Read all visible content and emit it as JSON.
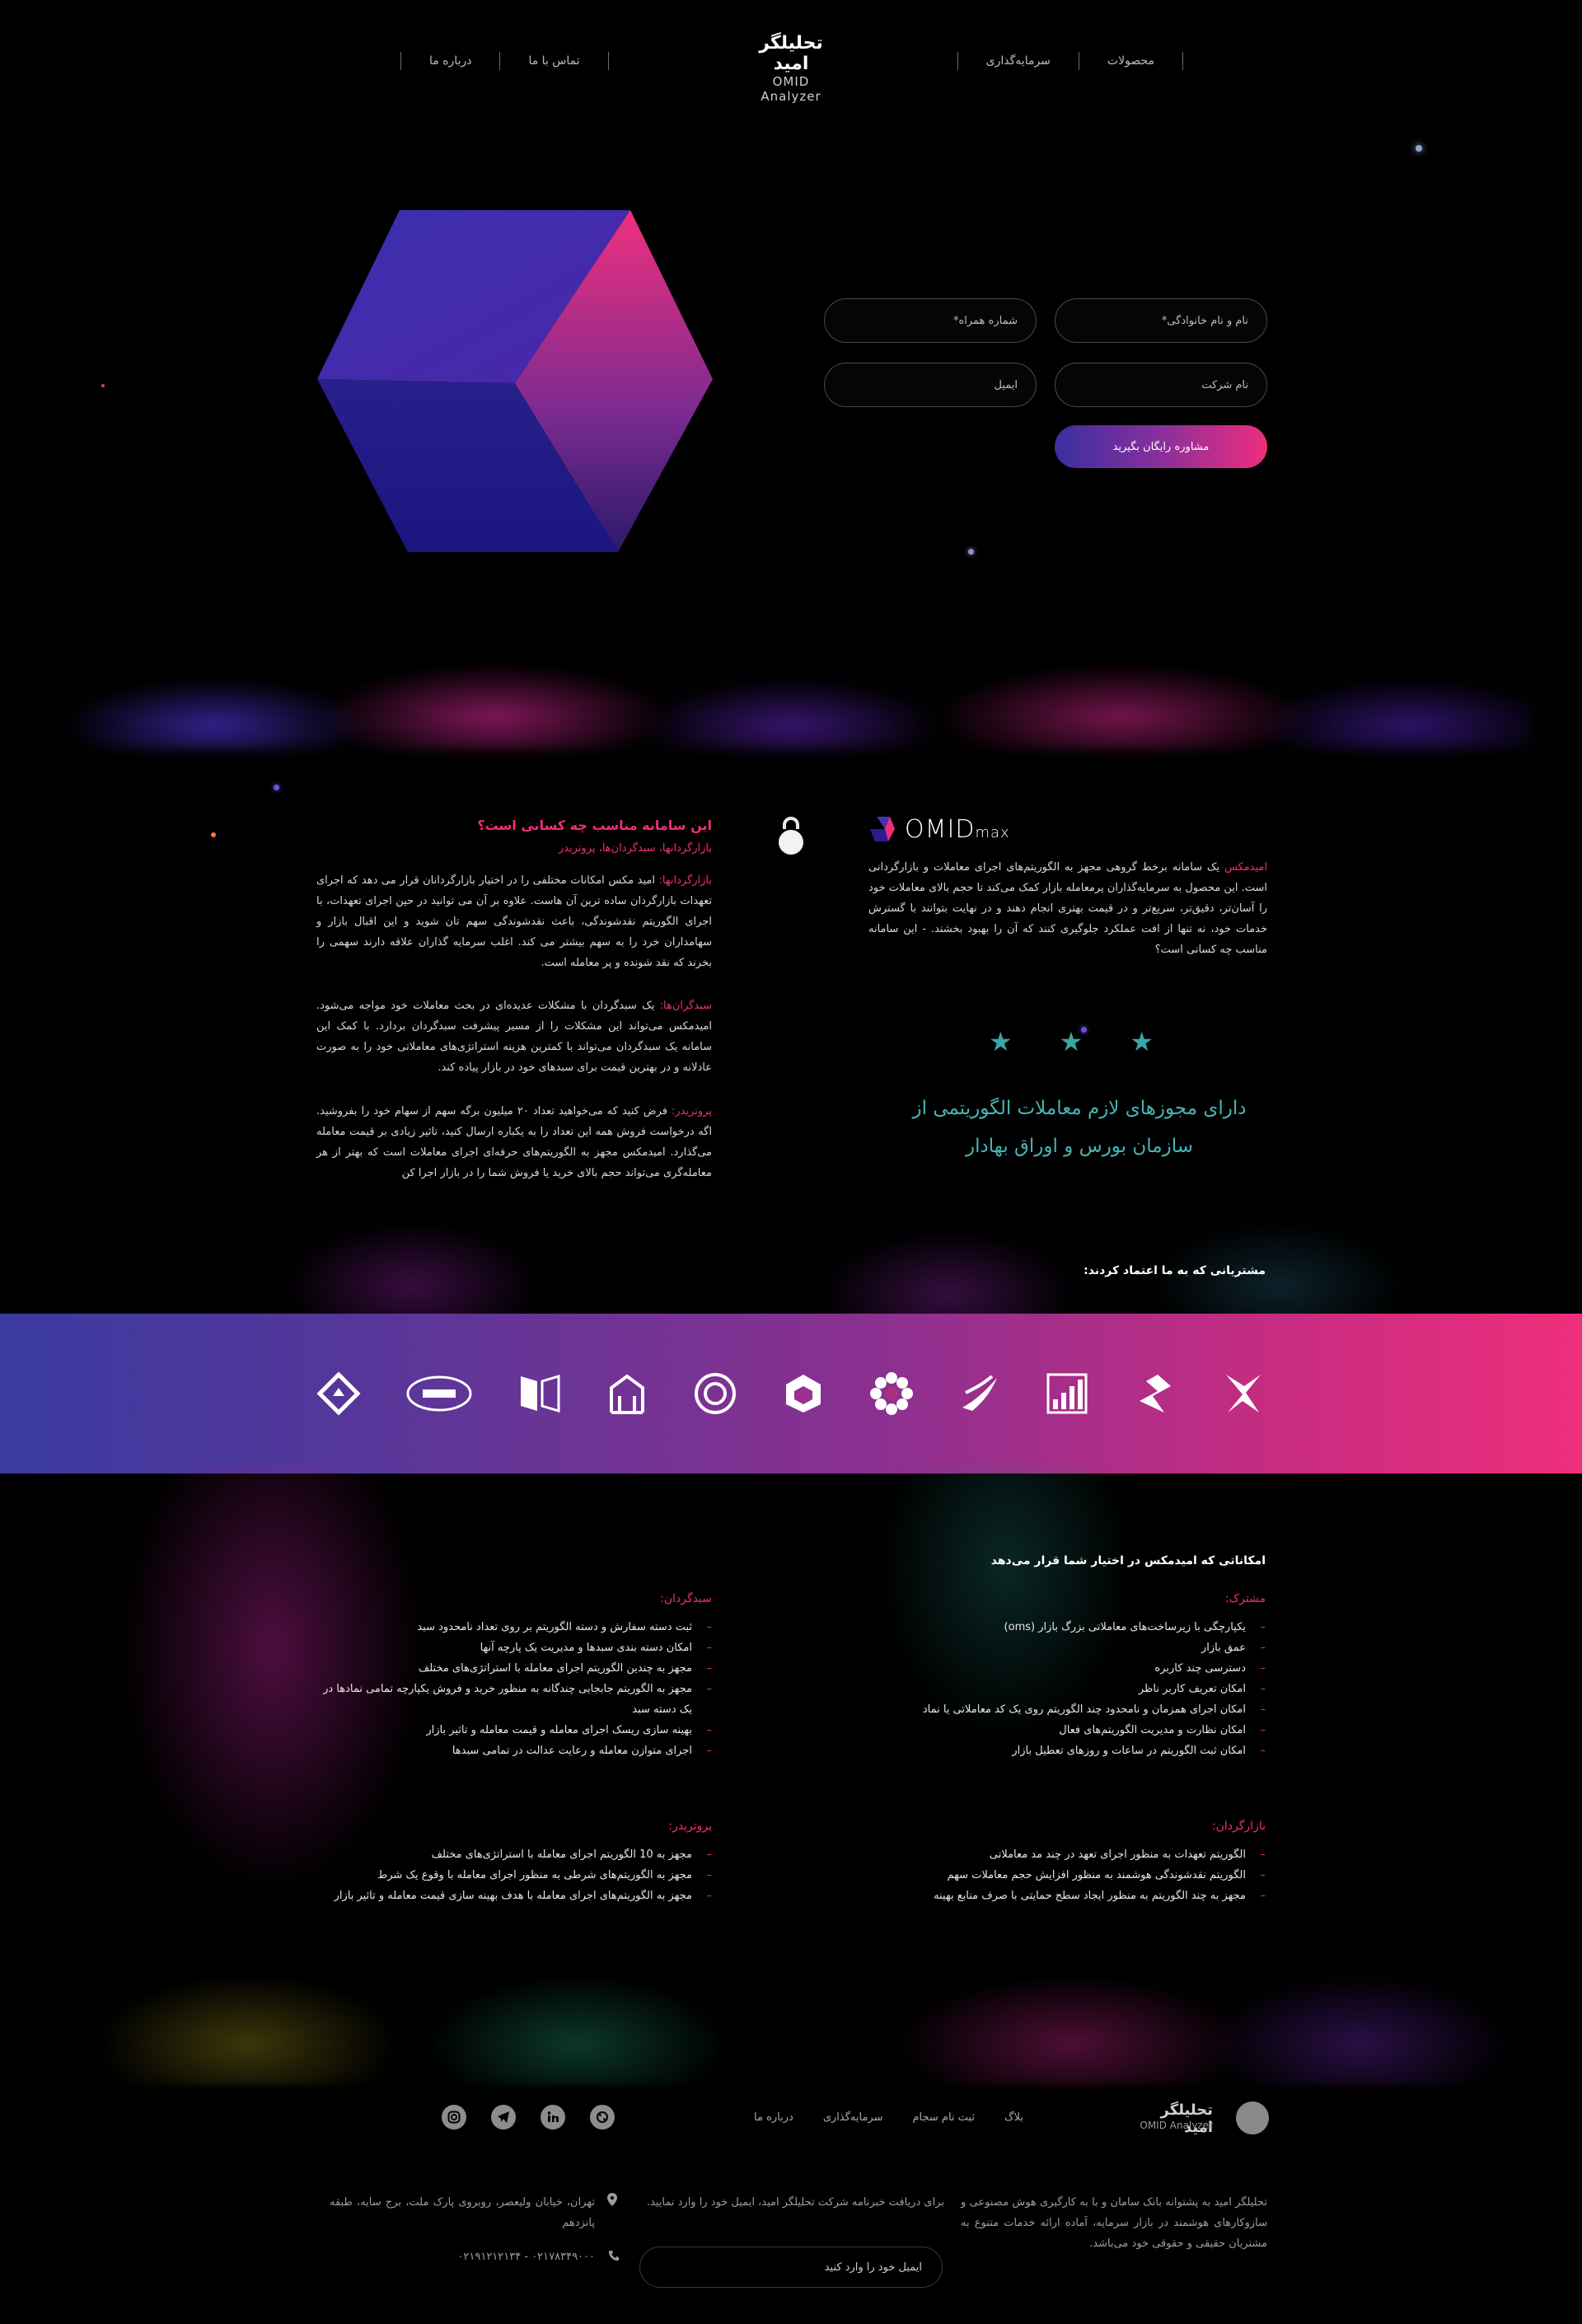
{
  "header": {
    "nav_right": [
      "محصولات",
      "سرمایه‌گذاری"
    ],
    "nav_left": [
      "تماس با ما",
      "درباره ما"
    ],
    "logo_fa": "تحلیلگر امید",
    "logo_en": "OMID Analyzer"
  },
  "form": {
    "name_placeholder": "نام و نام خانوادگی*",
    "phone_placeholder": "شماره همراه*",
    "company_placeholder": "نام شرکت",
    "email_placeholder": "ایمیل",
    "submit_label": "مشاوره رایگان بگیرید"
  },
  "product": {
    "logo_main": "OMID",
    "logo_sub": "max",
    "intro_highlight": "امیدمکس",
    "intro_text": " یک سامانه برخط گروهی مجهز به الگوریتم‌های اجرای معاملات و بازارگردانی است. این محصول به سرمایه‌گذاران پرمعامله بازار کمک می‌کند تا حجم بالای معاملات خود را آسان‌تر، دقیق‌تر، سریع‌تر و در قیمت بهتری انجام دهند و در نهایت بتوانند با گسترش خدمات خود، نه تنها از افت عملکرد جلوگیری کنند که آن را بهبود بخشند. - این سامانه مناسب چه کسانی است؟"
  },
  "audience": {
    "title": "این سامانه مناسب چه کسانی است؟",
    "subtitle": "بازارگردانها، سبدگردان‌ها، پروتریدر",
    "p1_highlight": "بازارگردانها:",
    "p1_text": " امید مکس امکانات مختلفی را در اختیار بازارگردانان قرار می دهد که اجرای تعهدات بازارگردان ساده ترین آن هاست. علاوه بر آن می توانید در حین اجرای تعهدات، با اجرای الگوریتم نقدشوندگی، باعث نقدشوندگی سهم تان شوید و این اقبال بازار و سهامداران خرد را به سهم بیشتر می کند. اغلب سرمایه گذاران علاقه دارند سهمی را بخرند که نقد شونده و پر معامله است.",
    "p2_highlight": "سبدگران‌ها:",
    "p2_text": " یک سبدگردان با مشکلات عدیده‌ای در بحث معاملات خود مواجه می‌شود. امیدمکس می‌تواند این مشکلات را از مسیر پیشرفت سبدگردان بردارد. با کمک این سامانه یک سبدگردان می‌تواند با کمترین هزینه استراتژی‌های معاملاتی خود را به صورت عادلانه و در بهترین قیمت برای سبدهای خود در بازار پیاده کند.",
    "p3_highlight": "پروتریدر:",
    "p3_text": " فرض کنید که می‌خواهید تعداد ۲۰ میلیون برگه سهم از سهام خود را بفروشید. اگه درخواست فروش همه این تعداد را به یکباره ارسال کنید، تاثیر زیادی بر قیمت معامله می‌گذارد. امیدمکس مجهز به الگوریتم‌های حرفه‌ای اجرای معاملات است که بهتر از هر معامله‌گری می‌تواند حجم بالای خرید یا فروش شما را در بازار اجرا کن"
  },
  "licence": {
    "stars": [
      "★",
      "★",
      "★"
    ],
    "line1": "دارای مجوزهای لازم معاملات الگوریتمی از",
    "line2": "سازمان بورس و اوراق بهادار"
  },
  "clients": {
    "title": "مشتریانی که به ما اعتماد کردند:"
  },
  "features": {
    "title": "امکاناتی که امیدمکس در اختیار شما قرار می‌دهد",
    "common_head": "مشترک:",
    "common": [
      "یکپارچگی با زیرساخت‌های معاملاتی بزرگ بازار (oms)",
      "عمق بازار",
      "دسترسی چند کاربره",
      "امکان تعریف کاربر ناظر",
      "امکان اجرای همزمان و نامحدود چند الگوریتم روی یک کد معاملاتی یا نماد",
      "امکان نظارت و مدیریت الگوریتم‌های فعال",
      "امکان ثبت الگوریتم در ساعات و روزهای تعطیل بازار"
    ],
    "portfolio_head": "سبدگردان:",
    "portfolio": [
      "ثبت دسته سفارش و دسته الگوریتم بر روی تعداد نامحدود سبد",
      "امکان دسته بندی سبدها و مدیریت یک پارچه آنها",
      "مجهز به چندین الگوریتم اجرای معامله با استراتژی‌های مختلف",
      "مجهز به الگوریتم جابجایی چندگانه به منظور خرید و فروش یکپارچه تمامی نمادها در یک دسته سبد",
      "بهینه سازی ریسک اجرای معامله و قیمت معامله و تاثیر بازار",
      "اجرای متوازن معامله و رعایت عدالت در تمامی سبدها"
    ],
    "market_head": "بازارگردان:",
    "market": [
      "الگوریتم تعهدات به منظور اجرای تعهد در چند مد معاملاتی",
      "الگوریتم نقدشوندگی هوشمند به منظور افزایش حجم معاملات سهم",
      "مجهز به چند الگوریتم به منظور ایجاد سطح حمایتی با صرف منابع بهینه"
    ],
    "pro_head": "پروتریدر:",
    "pro": [
      "مجهز به 10 الگوریتم اجرای معامله با استراتژی‌های مختلف",
      "مجهز به الگوریتم‌های شرطی به منظور اجرای معامله با وقوع یک شرط",
      "مجهز به الگوریتم‌های اجرای معامله با هدف بهینه سازی قیمت معامله و تاثیر بازار"
    ]
  },
  "footer": {
    "logo_fa": "تحلیلگر امید",
    "logo_en": "OMID Analyzer",
    "nav": [
      "بلاگ",
      "ثبت نام سجام",
      "سرمایه‌گذاری",
      "درباره ما"
    ],
    "about": "تحلیلگر امید به پشتوانه بانک سامان و با به کارگیری هوش مصنوعی و سازوکارهای هوشمند در بازار سرمایه، آماده ارائه خدمات متنوع به مشتریان حقیقی و حقوقی خود می‌باشد.",
    "newsletter": "برای دریافت خبرنامه شرکت تحلیلگر امید، ایمیل خود را وارد نمایید.",
    "newsletter_placeholder": "ایمیل خود را وارد کنید",
    "address": "تهران، خیابان ولیعصر، روبروی پارک ملت، برج سایه، طبقه پانزدهم",
    "phone": "۰۲۱۷۸۳۴۹۰۰۰ - ۰۲۱۹۱۲۱۲۱۳۴"
  },
  "colors": {
    "accent_pink": "#ee2e7b",
    "accent_purple": "#3a2fa0",
    "teal": "#46b4b4"
  }
}
